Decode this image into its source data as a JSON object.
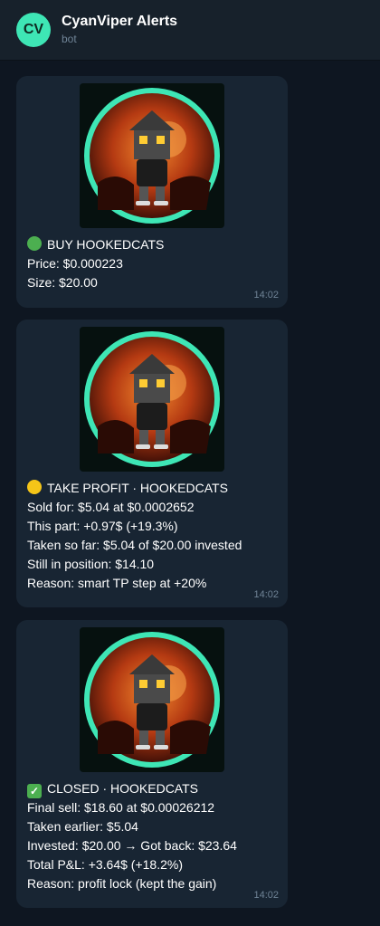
{
  "header": {
    "avatar_initials": "CV",
    "title": "CyanViper Alerts",
    "subtitle": "bot"
  },
  "messages": [
    {
      "lines": [
        "BUY HOOKEDCATS",
        "Price: $0.000223",
        "Size: $20.00"
      ],
      "emoji": "green-circle",
      "time": "14:02"
    },
    {
      "lines": [
        "TAKE PROFIT · HOOKEDCATS",
        "Sold for: $5.04 at $0.0002652",
        "This part: +0.97$ (+19.3%)",
        "Taken so far: $5.04 of $20.00 invested",
        "Still in position: $14.10",
        "Reason: smart TP step at +20%"
      ],
      "emoji": "yellow-circle",
      "time": "14:02"
    },
    {
      "lines": [
        "CLOSED · HOOKEDCATS",
        "Final sell: $18.60 at $0.00026212",
        "Taken earlier: $5.04",
        "Invested: $20.00 → Got back: $23.64",
        "Total P&L: +3.64$ (+18.2%)",
        "Reason: profit lock (kept the gain)"
      ],
      "emoji": "check-mark",
      "time": "14:02"
    }
  ],
  "colors": {
    "background": "#0e1621",
    "header": "#17212b",
    "bubble": "#182533",
    "accent": "#3ee6b5",
    "muted": "#6f8396"
  }
}
